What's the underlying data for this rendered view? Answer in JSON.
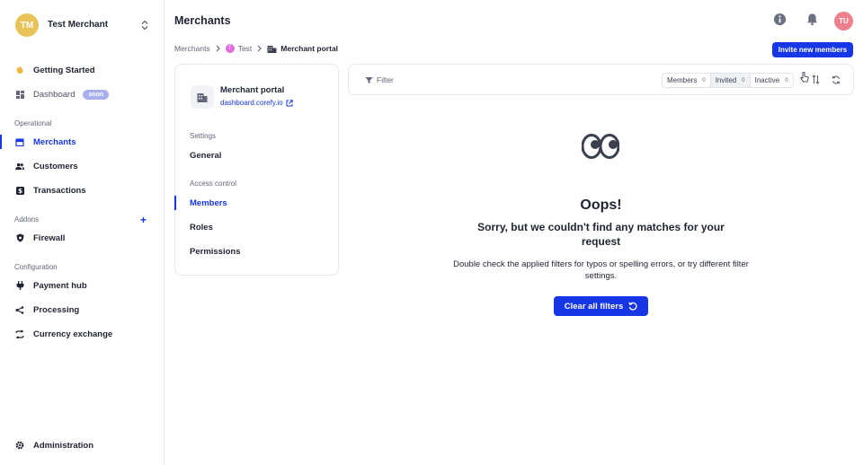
{
  "sidebar": {
    "merchant_initials": "TM",
    "merchant_name": "Test Merchant",
    "getting_started": "Getting Started",
    "dashboard": "Dashboard",
    "dashboard_badge": "soon",
    "section_operational": "Operational",
    "merchants": "Merchants",
    "customers": "Customers",
    "transactions": "Transactions",
    "section_addons": "Addons",
    "addons_add": "+",
    "firewall": "Firewall",
    "section_configuration": "Configuration",
    "payment_hub": "Payment hub",
    "processing": "Processing",
    "currency_exchange": "Currency exchange",
    "administration": "Administration"
  },
  "header": {
    "title": "Merchants",
    "user_initials": "TU"
  },
  "breadcrumb": {
    "root": "Merchants",
    "middle_initial": "T",
    "middle": "Test",
    "current": "Merchant portal"
  },
  "actions": {
    "invite": "Invite new members"
  },
  "settings_card": {
    "title": "Merchant portal",
    "link": "dashboard.corefy.io",
    "section_settings": "Settings",
    "general": "General",
    "section_access": "Access control",
    "members": "Members",
    "roles": "Roles",
    "permissions": "Permissions"
  },
  "filter_bar": {
    "filter_label": "Filter",
    "tabs": [
      {
        "label": "Members",
        "count": "0"
      },
      {
        "label": "Invited",
        "count": "0"
      },
      {
        "label": "Inactive",
        "count": "0"
      }
    ]
  },
  "empty_state": {
    "title": "Oops!",
    "subtitle": "Sorry, but we couldn't find any matches for your request",
    "hint": "Double check the applied filters for typos or spelling errors, or try different filter settings.",
    "clear_button": "Clear all filters"
  },
  "colors": {
    "accent": "#1736e6",
    "merchant_avatar": "#e7c35a",
    "user_avatar": "#ef7f8c",
    "badge": "#a9aeec"
  }
}
